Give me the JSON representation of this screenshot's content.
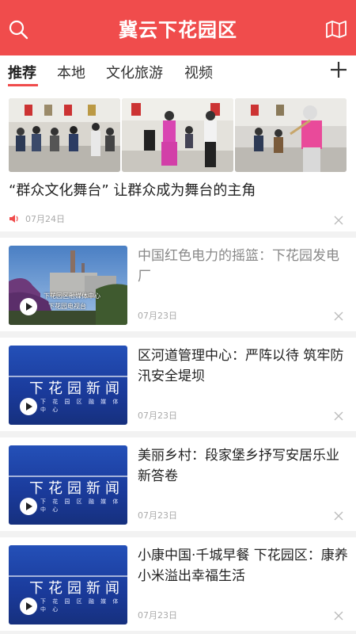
{
  "header": {
    "title": "冀云下花园区",
    "search_icon": "search-icon",
    "map_icon": "map-icon"
  },
  "tabs": [
    {
      "label": "推荐",
      "active": true
    },
    {
      "label": "本地",
      "active": false
    },
    {
      "label": "文化旅游",
      "active": false
    },
    {
      "label": "视频",
      "active": false
    }
  ],
  "add_icon": "plus-icon",
  "featured": {
    "title": "“群众文化舞台” 让群众成为舞台的主角",
    "date": "07月24日",
    "audio_icon": "speaker-icon"
  },
  "news": [
    {
      "title": "中国红色电力的摇篮：下花园发电厂",
      "date": "07月23日",
      "read": true,
      "caption1": "下花园区融媒体中心",
      "caption2": "下花园电视台"
    },
    {
      "title": "区河道管理中心：严阵以待 筑牢防汛安全堤坝",
      "date": "07月23日",
      "read": false,
      "thumb_big": "下花园新闻",
      "thumb_small": "下 花 园 区 融 媒 体 中 心"
    },
    {
      "title": "美丽乡村：段家堡乡抒写安居乐业新答卷",
      "date": "07月23日",
      "read": false,
      "thumb_big": "下花园新闻",
      "thumb_small": "下 花 园 区 融 媒 体 中 心"
    },
    {
      "title": "小康中国·千城早餐 下花园区：康养小米溢出幸福生活",
      "date": "07月23日",
      "read": false,
      "thumb_big": "下花园新闻",
      "thumb_small": "下 花 园 区 融 媒 体 中 心"
    }
  ],
  "colors": {
    "brand": "#f04c4c",
    "thumb_blue": "#1f44a8"
  }
}
